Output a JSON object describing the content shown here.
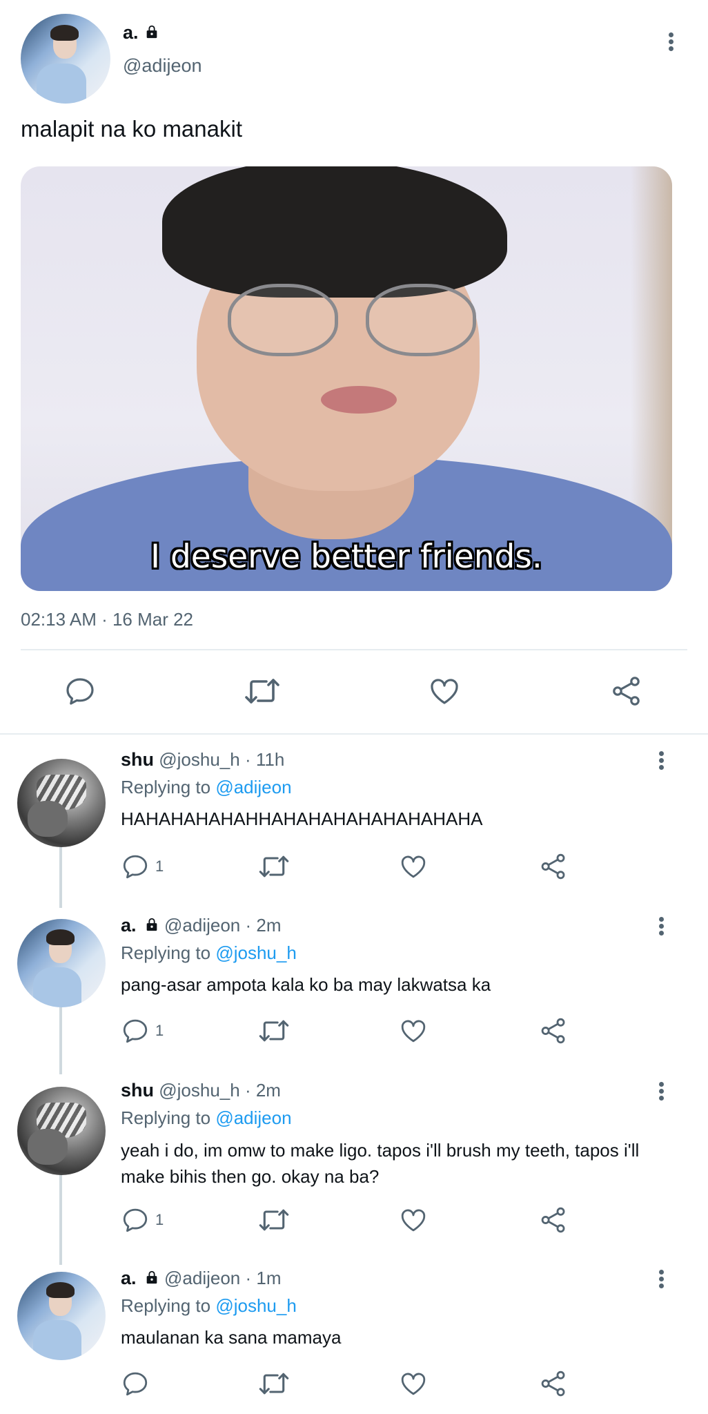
{
  "main_tweet": {
    "display_name": "a.",
    "handle": "@adijeon",
    "text": "malapit na ko manakit",
    "media_caption": "I deserve better friends.",
    "timestamp": "02:13 AM · 16 Mar 22",
    "actions": {
      "reply_icon": "reply-icon",
      "retweet_icon": "retweet-icon",
      "like_icon": "like-icon",
      "share_icon": "share-icon"
    }
  },
  "replies": [
    {
      "display_name": "shu",
      "handle": "@joshu_h",
      "time": "· 11h",
      "replying_prefix": "Replying to",
      "replying_to": "@adijeon",
      "text": "HAHAHAHAHAHHAHAHAHAHAHAHAHAHA",
      "reply_count": "1",
      "locked": false
    },
    {
      "display_name": "a.",
      "handle": "@adijeon",
      "time": "· 2m",
      "replying_prefix": "Replying to",
      "replying_to": "@joshu_h",
      "text": "pang-asar ampota kala ko ba may lakwatsa ka",
      "reply_count": "1",
      "locked": true
    },
    {
      "display_name": "shu",
      "handle": "@joshu_h",
      "time": "· 2m",
      "replying_prefix": "Replying to",
      "replying_to": "@adijeon",
      "text": "yeah i do, im omw to make ligo. tapos i'll brush my teeth, tapos i'll make bihis then go. okay na ba?",
      "reply_count": "1",
      "locked": false
    },
    {
      "display_name": "a.",
      "handle": "@adijeon",
      "time": "· 1m",
      "replying_prefix": "Replying to",
      "replying_to": "@joshu_h",
      "text": "maulanan ka sana mamaya",
      "reply_count": "",
      "locked": true
    }
  ],
  "colors": {
    "text_primary": "#0f1419",
    "text_secondary": "#536471",
    "link": "#1d9bf0",
    "divider": "#e6ecf0"
  }
}
